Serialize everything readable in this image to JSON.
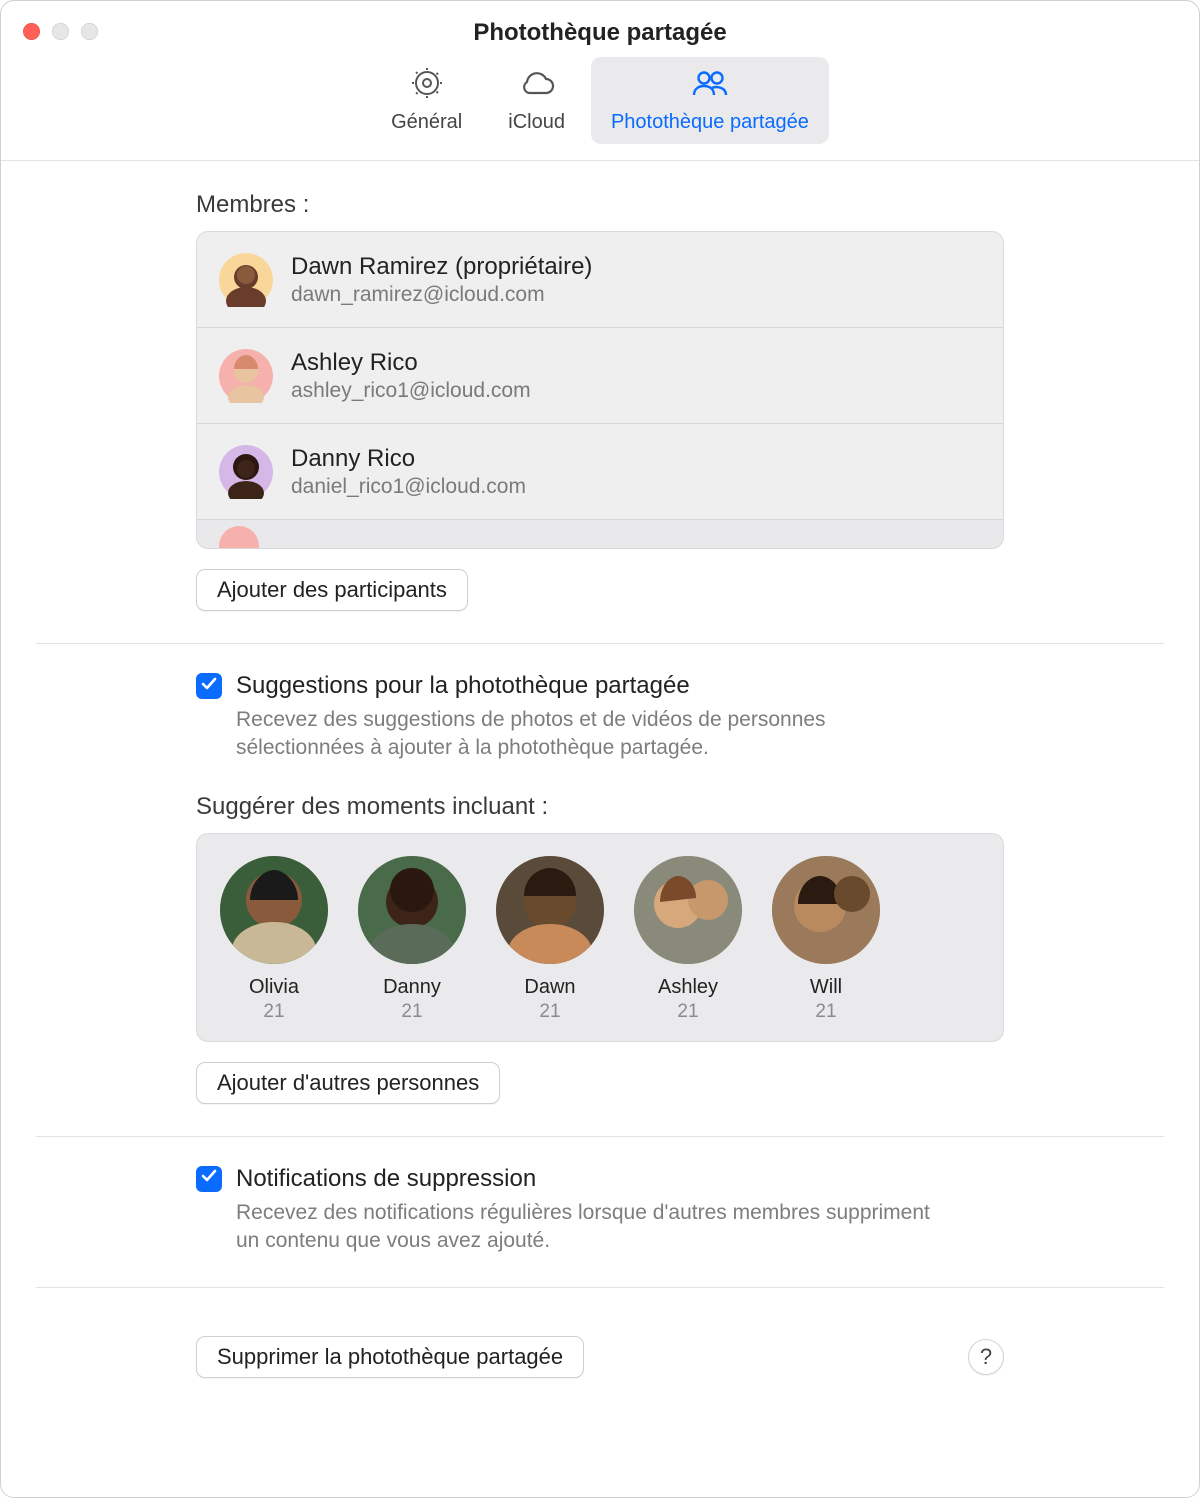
{
  "window_title": "Photothèque partagée",
  "tabs": {
    "general": "Général",
    "icloud": "iCloud",
    "shared": "Photothèque partagée"
  },
  "members": {
    "label": "Membres :",
    "items": [
      {
        "name": "Dawn Ramirez (propriétaire)",
        "email": "dawn_ramirez@icloud.com"
      },
      {
        "name": "Ashley Rico",
        "email": "ashley_rico1@icloud.com"
      },
      {
        "name": "Danny Rico",
        "email": "daniel_rico1@icloud.com"
      }
    ],
    "add_button": "Ajouter des participants"
  },
  "suggestions": {
    "checkbox_label": "Suggestions pour la photothèque partagée",
    "description": "Recevez des suggestions de photos et de vidéos de personnes sélectionnées à ajouter à la photothèque partagée.",
    "moments_label": "Suggérer des moments incluant :",
    "people": [
      {
        "name": "Olivia",
        "count": "21"
      },
      {
        "name": "Danny",
        "count": "21"
      },
      {
        "name": "Dawn",
        "count": "21"
      },
      {
        "name": "Ashley",
        "count": "21"
      },
      {
        "name": "Will",
        "count": "21"
      }
    ],
    "add_people_button": "Ajouter d'autres personnes"
  },
  "deletion": {
    "checkbox_label": "Notifications de suppression",
    "description": "Recevez des notifications régulières lorsque d'autres membres suppriment un contenu que vous avez ajouté."
  },
  "delete_button": "Supprimer la photothèque partagée",
  "help_label": "?"
}
